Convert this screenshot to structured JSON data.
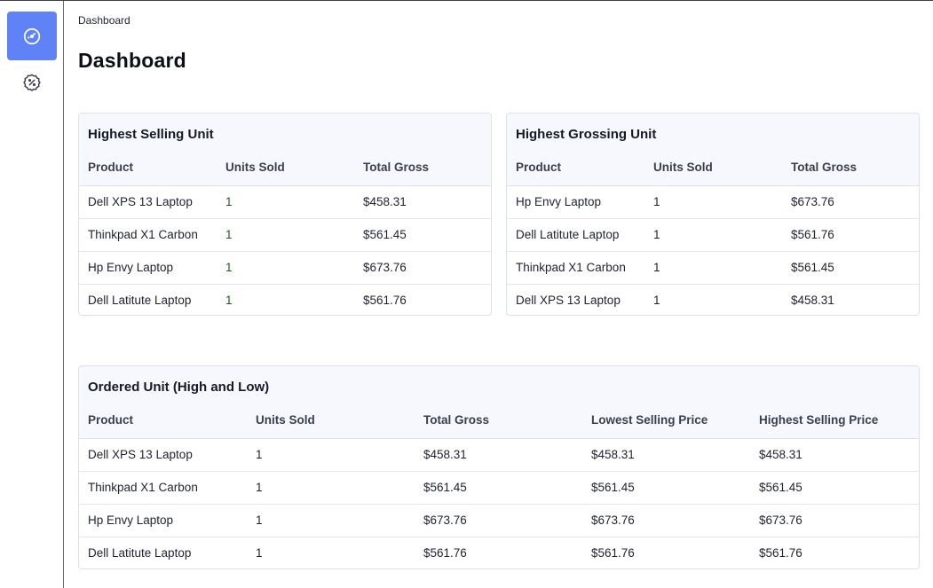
{
  "breadcrumb": "Dashboard",
  "title": "Dashboard",
  "sidebar": {
    "items": [
      {
        "icon": "speedometer-icon",
        "active": true
      },
      {
        "icon": "percent-badge-icon",
        "active": false
      }
    ]
  },
  "colors": {
    "accent": "#5f82f6",
    "border": "#dde1ea",
    "header_bg": "#f7f8fd"
  },
  "highest_selling": {
    "title": "Highest Selling Unit",
    "columns": [
      "Product",
      "Units Sold",
      "Total Gross"
    ],
    "rows": [
      [
        "Dell XPS 13 Laptop",
        "1",
        "$458.31"
      ],
      [
        "Thinkpad X1 Carbon",
        "1",
        "$561.45"
      ],
      [
        "Hp Envy Laptop",
        "1",
        "$673.76"
      ],
      [
        "Dell Latitute Laptop",
        "1",
        "$561.76"
      ]
    ]
  },
  "highest_grossing": {
    "title": "Highest Grossing Unit",
    "columns": [
      "Product",
      "Units Sold",
      "Total Gross"
    ],
    "rows": [
      [
        "Hp Envy Laptop",
        "1",
        "$673.76"
      ],
      [
        "Dell Latitute Laptop",
        "1",
        "$561.76"
      ],
      [
        "Thinkpad X1 Carbon",
        "1",
        "$561.45"
      ],
      [
        "Dell XPS 13 Laptop",
        "1",
        "$458.31"
      ]
    ]
  },
  "ordered": {
    "title": "Ordered Unit (High and Low)",
    "columns": [
      "Product",
      "Units Sold",
      "Total Gross",
      "Lowest Selling Price",
      "Highest Selling Price"
    ],
    "rows": [
      [
        "Dell XPS 13 Laptop",
        "1",
        "$458.31",
        "$458.31",
        "$458.31"
      ],
      [
        "Thinkpad X1 Carbon",
        "1",
        "$561.45",
        "$561.45",
        "$561.45"
      ],
      [
        "Hp Envy Laptop",
        "1",
        "$673.76",
        "$673.76",
        "$673.76"
      ],
      [
        "Dell Latitute Laptop",
        "1",
        "$561.76",
        "$561.76",
        "$561.76"
      ]
    ]
  }
}
